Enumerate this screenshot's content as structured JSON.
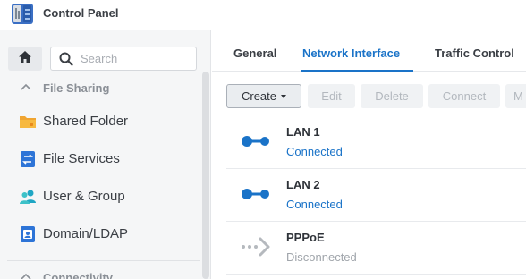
{
  "app": {
    "title": "Control Panel"
  },
  "sidebar": {
    "search": {
      "placeholder": "Search",
      "value": ""
    },
    "sections": [
      {
        "label": "File Sharing",
        "items": [
          {
            "label": "Shared Folder",
            "icon": "folder-icon"
          },
          {
            "label": "File Services",
            "icon": "file-services-icon"
          },
          {
            "label": "User & Group",
            "icon": "user-group-icon"
          },
          {
            "label": "Domain/LDAP",
            "icon": "domain-ldap-icon"
          }
        ]
      },
      {
        "label": "Connectivity",
        "items": []
      }
    ]
  },
  "tabs": [
    {
      "label": "General",
      "active": false
    },
    {
      "label": "Network Interface",
      "active": true
    },
    {
      "label": "Traffic Control",
      "active": false
    }
  ],
  "toolbar": {
    "create_label": "Create",
    "edit_label": "Edit",
    "delete_label": "Delete",
    "connect_label": "Connect",
    "more_label": "M"
  },
  "interfaces": [
    {
      "name": "LAN 1",
      "status": "Connected",
      "icon": "lan-connected-icon"
    },
    {
      "name": "LAN 2",
      "status": "Connected",
      "icon": "lan-connected-icon"
    },
    {
      "name": "PPPoE",
      "status": "Disconnected",
      "icon": "pppoe-disconnected-icon"
    }
  ],
  "colors": {
    "accent": "#1a73c8",
    "connected": "#1a73c8",
    "disconnected": "#a0a5ab",
    "sidebar_bg": "#f5f6f7"
  }
}
